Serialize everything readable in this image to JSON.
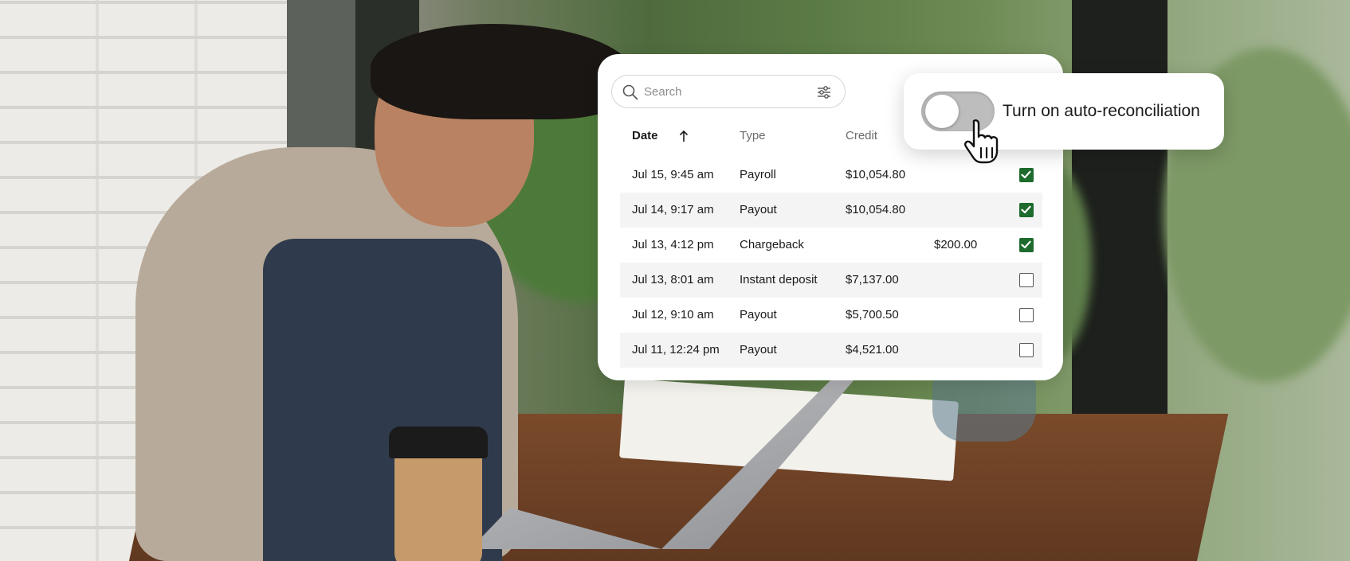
{
  "search": {
    "placeholder": "Search",
    "icon": "search-icon",
    "filter_icon": "sliders-icon"
  },
  "table": {
    "columns": {
      "date": "Date",
      "type": "Type",
      "credit": "Credit"
    },
    "sort": {
      "column": "date",
      "direction": "ascending",
      "icon": "arrow-up-icon"
    },
    "rows": [
      {
        "date": "Jul 15, 9:45 am",
        "type": "Payroll",
        "credit": "$10,054.80",
        "debit": "",
        "reconciled": true
      },
      {
        "date": "Jul 14, 9:17 am",
        "type": "Payout",
        "credit": "$10,054.80",
        "debit": "",
        "reconciled": true
      },
      {
        "date": "Jul 13, 4:12 pm",
        "type": "Chargeback",
        "credit": "",
        "debit": "$200.00",
        "reconciled": true
      },
      {
        "date": "Jul 13, 8:01 am",
        "type": "Instant deposit",
        "credit": "$7,137.00",
        "debit": "",
        "reconciled": false
      },
      {
        "date": "Jul 12, 9:10 am",
        "type": "Payout",
        "credit": "$5,700.50",
        "debit": "",
        "reconciled": false
      },
      {
        "date": "Jul 11, 12:24 pm",
        "type": "Payout",
        "credit": "$4,521.00",
        "debit": "",
        "reconciled": false
      }
    ]
  },
  "toggle": {
    "label": "Turn on auto-reconciliation",
    "state": "off",
    "cursor_icon": "hand-pointer-icon"
  },
  "colors": {
    "check_green": "#1e6b2d",
    "toggle_off": "#bdbdbd",
    "row_alt": "#f4f4f4"
  }
}
